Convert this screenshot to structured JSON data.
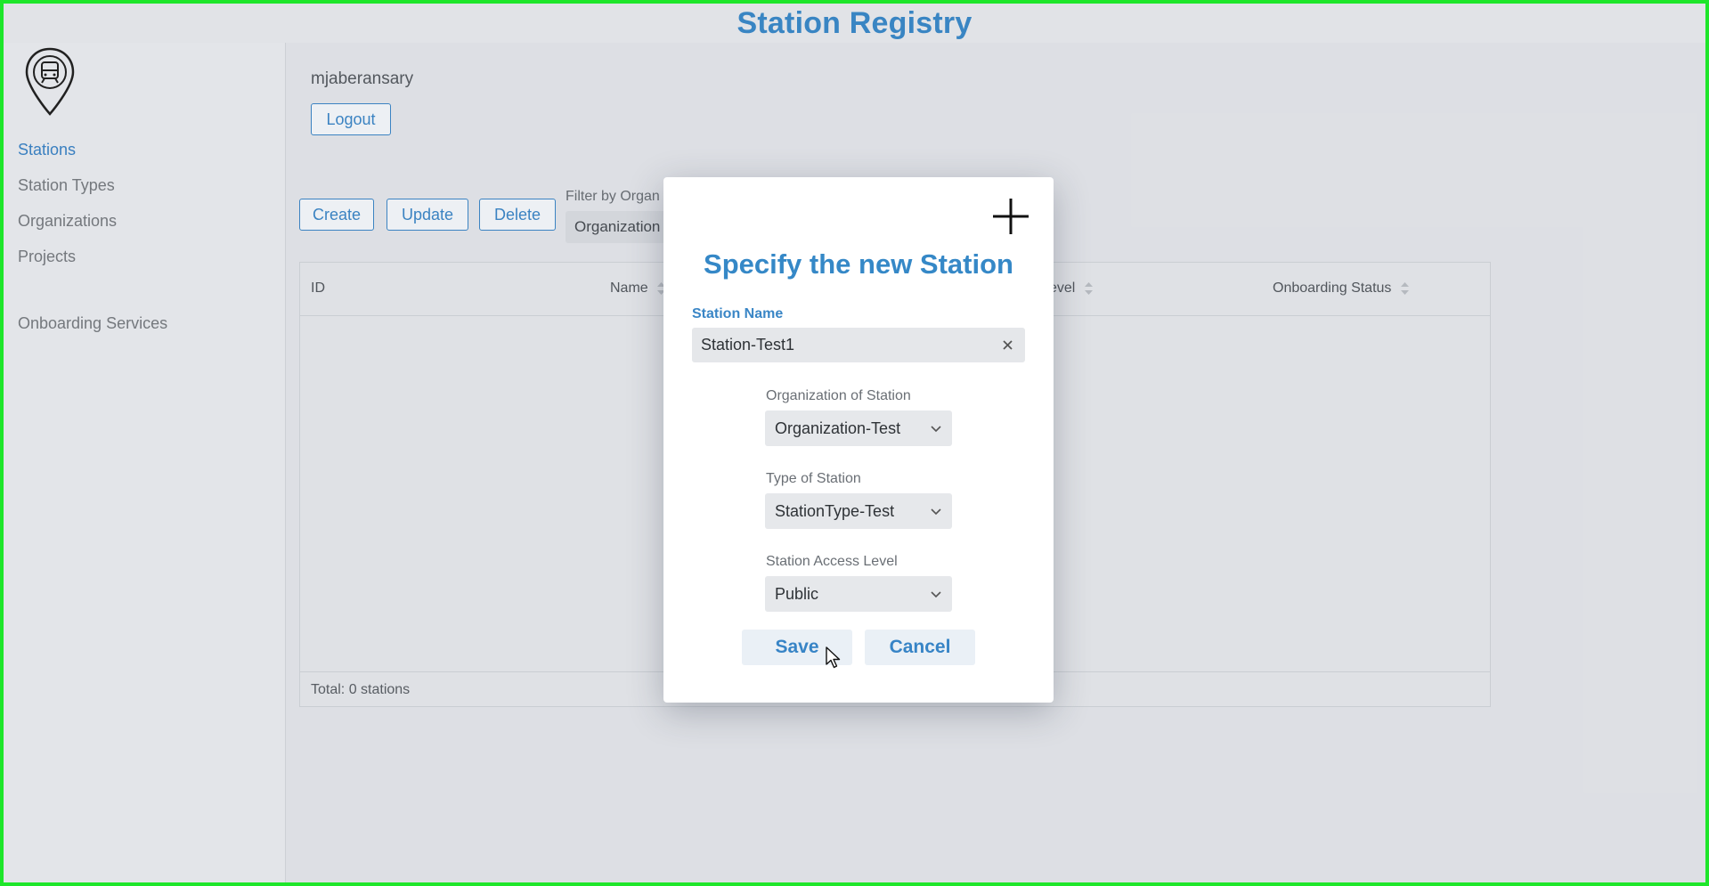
{
  "app": {
    "title": "Station Registry"
  },
  "sidebar": {
    "items": [
      {
        "label": "Stations",
        "active": true
      },
      {
        "label": "Station Types"
      },
      {
        "label": "Organizations"
      },
      {
        "label": "Projects"
      },
      {
        "label": "Onboarding Services"
      }
    ],
    "logo_icon": "train-location-pin-icon"
  },
  "user": {
    "name": "mjaberansary",
    "logout_label": "Logout"
  },
  "toolbar": {
    "create_label": "Create",
    "update_label": "Update",
    "delete_label": "Delete",
    "filter_label": "Filter by Organ",
    "filter_value": "Organization"
  },
  "table": {
    "columns": [
      "ID",
      "Name",
      "evel",
      "Onboarding Status"
    ],
    "footer": "Total: 0 stations"
  },
  "modal": {
    "title": "Specify the new Station",
    "close_icon": "plus-icon",
    "station_name_label": "Station Name",
    "station_name_value": "Station-Test1",
    "organization_label": "Organization of Station",
    "organization_value": "Organization-Test",
    "type_label": "Type of Station",
    "type_value": "StationType-Test",
    "access_label": "Station Access Level",
    "access_value": "Public",
    "save_label": "Save",
    "cancel_label": "Cancel"
  },
  "colors": {
    "accent": "#3b88c7",
    "frame_border": "#1ee62a",
    "background": "#e3e5e9"
  }
}
